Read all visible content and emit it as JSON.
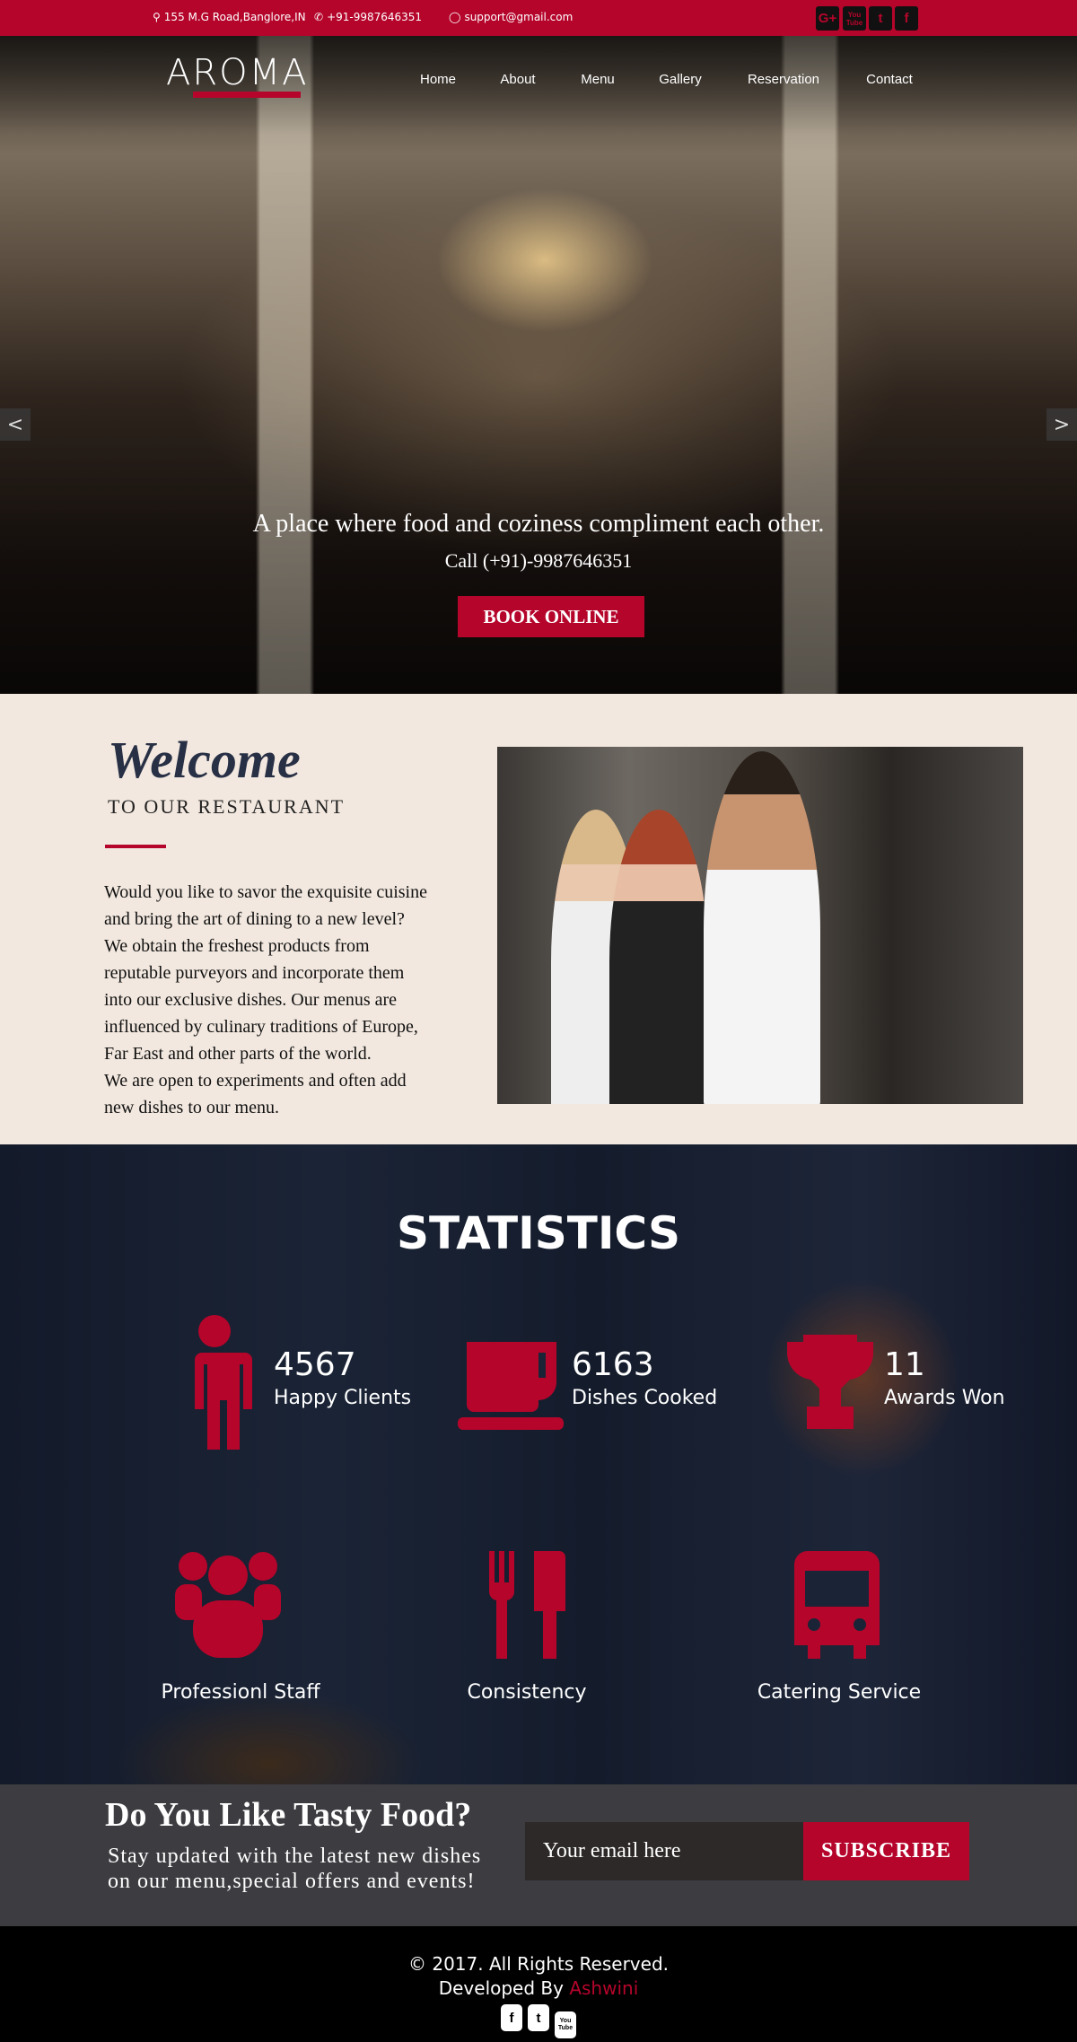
{
  "topbar": {
    "address": "155 M.G Road,Banglore,IN",
    "phone": "+91-9987646351",
    "email": "support@gmail.com",
    "social": [
      "G+",
      "You Tube",
      "t",
      "f"
    ]
  },
  "header": {
    "logo": "AROMA",
    "nav": [
      "Home",
      "About",
      "Menu",
      "Gallery",
      "Reservation",
      "Contact"
    ]
  },
  "hero": {
    "tagline": "A place where food and coziness compliment each other.",
    "call": "Call (+91)-9987646351",
    "button": "BOOK ONLINE",
    "prev": "<",
    "next": ">"
  },
  "welcome": {
    "title": "Welcome",
    "subtitle": "TO OUR RESTAURANT",
    "text": "Would you like to savor the exquisite cuisine\nand bring the art of dining to a new level?\nWe obtain the freshest products from\nreputable purveyors and incorporate them\n into our exclusive dishes. Our menus are\ninfluenced by culinary traditions of Europe,\n Far East and other parts of the world.\nWe are open to experiments and often add\nnew dishes to our menu."
  },
  "stats": {
    "title": "STATISTICS",
    "counters": [
      {
        "value": "4567",
        "label": "Happy Clients"
      },
      {
        "value": "6163",
        "label": "Dishes Cooked"
      },
      {
        "value": "11",
        "label": "Awards Won"
      }
    ],
    "features": [
      "Professionl Staff",
      "Consistency",
      "Catering Service"
    ]
  },
  "subscribe": {
    "title": "Do You Like Tasty Food?",
    "line1": "Stay updated with the latest new dishes",
    "line2": "on our menu,special offers and events!",
    "placeholder": "Your email here",
    "button": "SUBSCRIBE"
  },
  "footer": {
    "copyright": "© 2017. All Rights Reserved.",
    "developed": "Developed By ",
    "author": "Ashwini",
    "social": [
      "f",
      "t",
      "You Tube"
    ]
  },
  "colors": {
    "accent": "#b5052b",
    "navy": "#283046"
  }
}
